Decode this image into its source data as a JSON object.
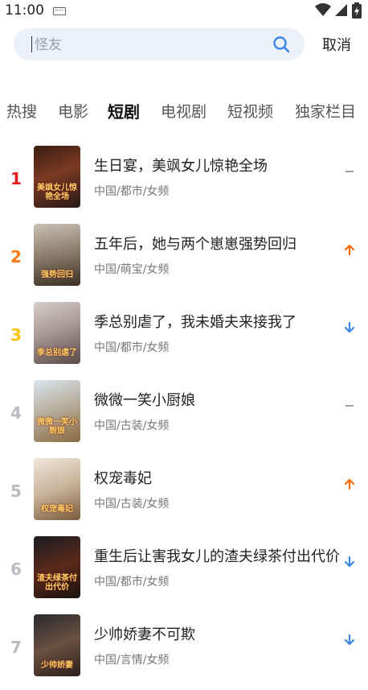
{
  "status_bar": {
    "time": "11:00"
  },
  "search": {
    "placeholder": "怪友",
    "cancel_label": "取消"
  },
  "tabs": [
    {
      "label": "热搜",
      "active": false
    },
    {
      "label": "电影",
      "active": false
    },
    {
      "label": "短剧",
      "active": true
    },
    {
      "label": "电视剧",
      "active": false
    },
    {
      "label": "短视频",
      "active": false
    },
    {
      "label": "独家栏目",
      "active": false
    }
  ],
  "colors": {
    "rank_1": "#e31b1b",
    "rank_2": "#ff7a14",
    "rank_3": "#ffc20e",
    "rank_other": "#b9bcc2",
    "trend_up": "#ff6a00",
    "trend_down": "#3a86e8",
    "trend_flat": "#888888",
    "search_bg": "#eaf1fb",
    "search_icon": "#3a86e8"
  },
  "ranking": [
    {
      "rank": "1",
      "title": "生日宴，美飒女儿惊艳全场",
      "tags": "中国/都市/女频",
      "trend": "flat",
      "trend_icon": "dash-icon",
      "cover_title": "美飒女儿惊艳全场"
    },
    {
      "rank": "2",
      "title": "五年后，她与两个崽崽强势回归",
      "tags": "中国/萌宝/女频",
      "trend": "up",
      "trend_icon": "arrow-up-icon",
      "cover_title": "强势回归"
    },
    {
      "rank": "3",
      "title": "季总别虐了，我未婚夫来接我了",
      "tags": "中国/都市/女频",
      "trend": "down",
      "trend_icon": "arrow-down-icon",
      "cover_title": "季总别虐了"
    },
    {
      "rank": "4",
      "title": "微微一笑小厨娘",
      "tags": "中国/古装/女频",
      "trend": "flat",
      "trend_icon": "dash-icon",
      "cover_title": "微微一笑小厨娘"
    },
    {
      "rank": "5",
      "title": "权宠毒妃",
      "tags": "中国/古装/女频",
      "trend": "up",
      "trend_icon": "arrow-up-icon",
      "cover_title": "权宠毒妃"
    },
    {
      "rank": "6",
      "title": "重生后让害我女儿的渣夫绿茶付出代价",
      "tags": "中国/都市/女频",
      "trend": "down",
      "trend_icon": "arrow-down-icon",
      "cover_title": "渣夫绿茶付出代价"
    },
    {
      "rank": "7",
      "title": "少帅娇妻不可欺",
      "tags": "中国/言情/女频",
      "trend": "down",
      "trend_icon": "arrow-down-icon",
      "cover_title": "少帅娇妻"
    }
  ]
}
